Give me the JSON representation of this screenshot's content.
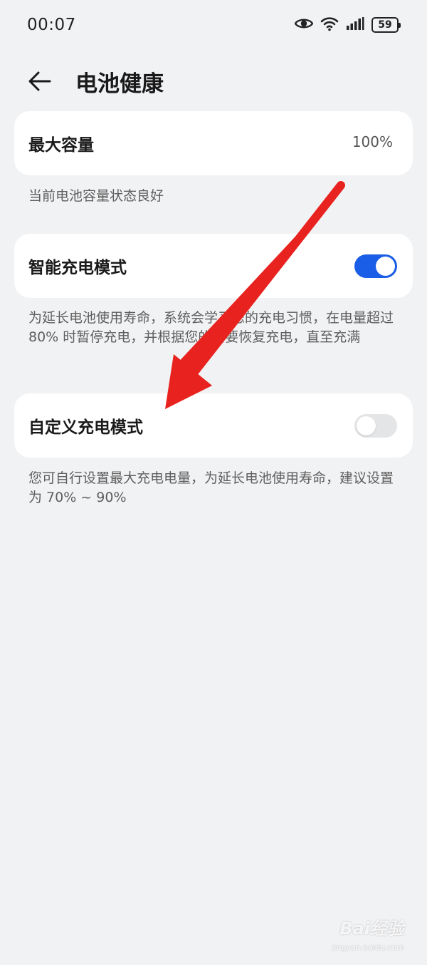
{
  "status_bar": {
    "time": "00:07",
    "battery_level": "59",
    "icons": [
      "eye-icon",
      "wifi-icon",
      "signal-icon",
      "battery-icon"
    ]
  },
  "header": {
    "title": "电池健康",
    "back_icon": "arrow-left-icon"
  },
  "sections": {
    "max_capacity": {
      "label": "最大容量",
      "value": "100%",
      "description": "当前电池容量状态良好"
    },
    "smart_charging": {
      "label": "智能充电模式",
      "enabled": true,
      "description": "为延长电池使用寿命，系统会学习您的充电习惯，在电量超过 80% 时暂停充电，并根据您的需要恢复充电，直至充满"
    },
    "custom_charging": {
      "label": "自定义充电模式",
      "enabled": false,
      "description": "您可自行设置最大充电电量，为延长电池使用寿命，建议设置为 70% ~ 90%"
    }
  },
  "colors": {
    "background": "#f1f2f4",
    "card": "#ffffff",
    "toggle_on": "#1a5de6",
    "toggle_off": "#e4e5e7",
    "annotation_arrow": "#e8231f"
  },
  "watermark": {
    "text": "Bai经验",
    "sub": "jingyan.baidu.com"
  }
}
